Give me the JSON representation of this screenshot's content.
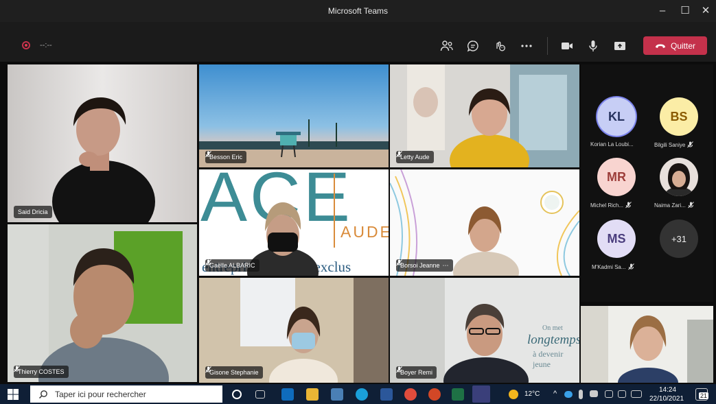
{
  "window": {
    "title": "Microsoft Teams",
    "minimize_glyph": "–",
    "maximize_glyph": "☐",
    "close_glyph": "✕"
  },
  "toolbar": {
    "recording_timer": "--:--",
    "leave_label": "Quitter",
    "icons": [
      "people-icon",
      "chat-icon",
      "reactions-icon",
      "more-icon",
      "camera-icon",
      "microphone-icon",
      "share-icon"
    ],
    "leave_color": "#c4314b"
  },
  "participants": [
    {
      "name": "Said Dricia",
      "muted": false
    },
    {
      "name": "Besson Eric",
      "muted": true
    },
    {
      "name": "Letty Aude",
      "muted": true
    },
    {
      "name": "Gaëlle ALBARIC",
      "muted": true
    },
    {
      "name": "Borsoi Jeanne",
      "muted": true
    },
    {
      "name": "Thierry COSTES",
      "muted": true
    },
    {
      "name": "Gisone Stephanie",
      "muted": true
    },
    {
      "name": "Boyer Remi",
      "muted": true
    },
    {
      "name": "",
      "muted": false
    }
  ],
  "slide_text": {
    "big": "ACE",
    "aude": "AUDE",
    "bottom": "entreprises contre l'exclus"
  },
  "wall_text": {
    "line1": "On met",
    "line2": "longtemps",
    "line3": "à devenir jeune"
  },
  "roster": [
    {
      "initials": "KL",
      "name": "Korian La Loubi...",
      "muted": false,
      "color": "#c7cef5",
      "text_color": "#27335f",
      "ring": true
    },
    {
      "initials": "BS",
      "name": "Bilgili Saniye",
      "muted": true,
      "color": "#fbeda6",
      "text_color": "#8a5a00",
      "ring": false
    },
    {
      "initials": "MR",
      "name": "Michel Rich...",
      "muted": true,
      "color": "#f8d4d0",
      "text_color": "#9c3d3a",
      "ring": false
    },
    {
      "initials": "",
      "name": "Naima Zari...",
      "muted": true,
      "color": "#3a2a22",
      "text_color": "#fff",
      "ring": false
    },
    {
      "initials": "MS",
      "name": "M'Kadmi Sa...",
      "muted": true,
      "color": "#e2ddf5",
      "text_color": "#4a3d7d",
      "ring": false
    }
  ],
  "overflow_count": "+31",
  "taskbar": {
    "search_placeholder": "Taper ici pour rechercher",
    "temperature": "12°C",
    "time": "14:24",
    "date": "22/10/2021",
    "notification_count": "21"
  }
}
